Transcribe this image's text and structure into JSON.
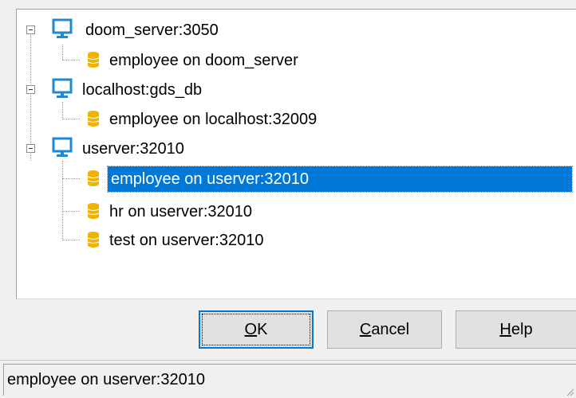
{
  "tree": {
    "nodes": [
      {
        "label": "doom_server:3050",
        "icon": "server-monitor-icon",
        "expanded": true,
        "children": [
          {
            "label": "employee on doom_server",
            "icon": "database-icon",
            "selected": false
          }
        ]
      },
      {
        "label": "localhost:gds_db",
        "icon": "server-monitor-icon",
        "expanded": true,
        "children": [
          {
            "label": "employee on localhost:32009",
            "icon": "database-icon",
            "selected": false
          }
        ]
      },
      {
        "label": "userver:32010",
        "icon": "server-monitor-icon",
        "expanded": true,
        "children": [
          {
            "label": "employee on userver:32010",
            "icon": "database-icon",
            "selected": true
          },
          {
            "label": "hr on userver:32010",
            "icon": "database-icon",
            "selected": false
          },
          {
            "label": "test on userver:32010",
            "icon": "database-icon",
            "selected": false
          }
        ]
      }
    ]
  },
  "buttons": {
    "ok": {
      "accel": "O",
      "rest": "K"
    },
    "cancel": {
      "accel": "C",
      "rest": "ancel"
    },
    "help": {
      "accel": "H",
      "rest": "elp"
    }
  },
  "statusbar": {
    "text": "employee on userver:32010"
  },
  "colors": {
    "selection": "#0078d7",
    "db_icon": "#f0b400",
    "monitor_icon": "#1e88d2",
    "window_bg": "#f0f0f0"
  }
}
